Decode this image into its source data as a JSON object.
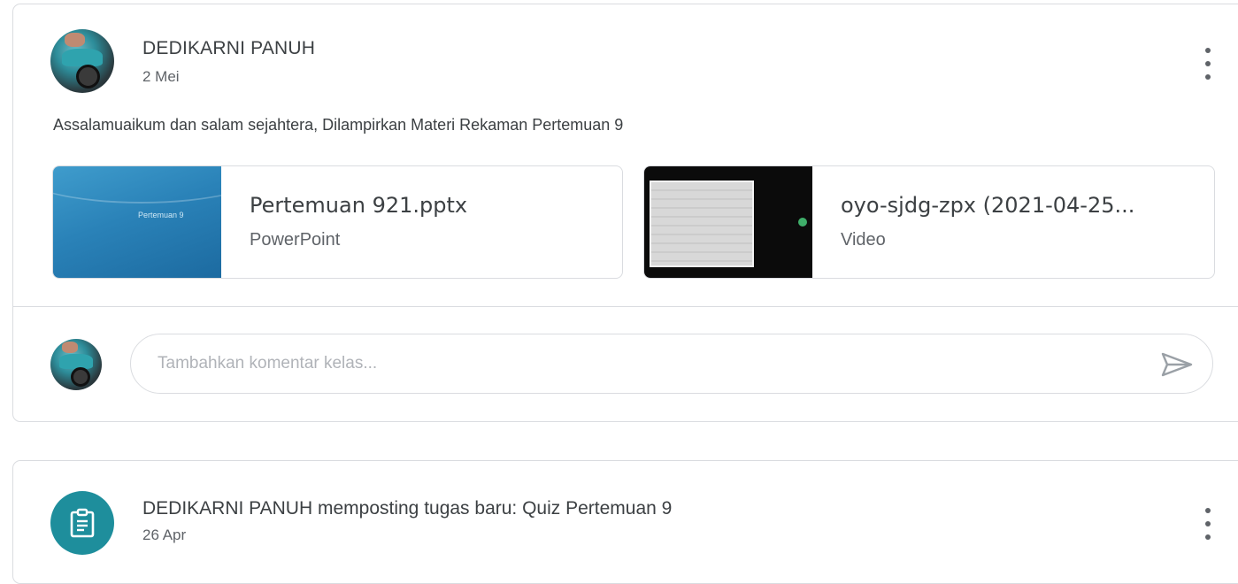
{
  "post": {
    "author": "DEDIKARNI PANUH",
    "date": "2 Mei",
    "text": "Assalamuaikum dan salam sejahtera, Dilampirkan Materi Rekaman Pertemuan 9",
    "attachments": [
      {
        "name": "Pertemuan 921.pptx",
        "type": "PowerPoint",
        "thumbnail_text": "Pertemuan 9",
        "icon": "powerpoint-thumbnail"
      },
      {
        "name": "oyo-sjdg-zpx (2021-04-25...",
        "type": "Video",
        "icon": "video-thumbnail"
      }
    ],
    "comment": {
      "placeholder": "Tambahkan komentar kelas...",
      "send_icon": "send-icon"
    }
  },
  "assignment": {
    "title": "DEDIKARNI PANUH memposting tugas baru: Quiz Pertemuan 9",
    "date": "26 Apr",
    "icon": "assignment-icon"
  },
  "colors": {
    "accent": "#1e8e9c",
    "border": "#dadce0",
    "text": "#3c4043",
    "secondary_text": "#5f6368"
  }
}
